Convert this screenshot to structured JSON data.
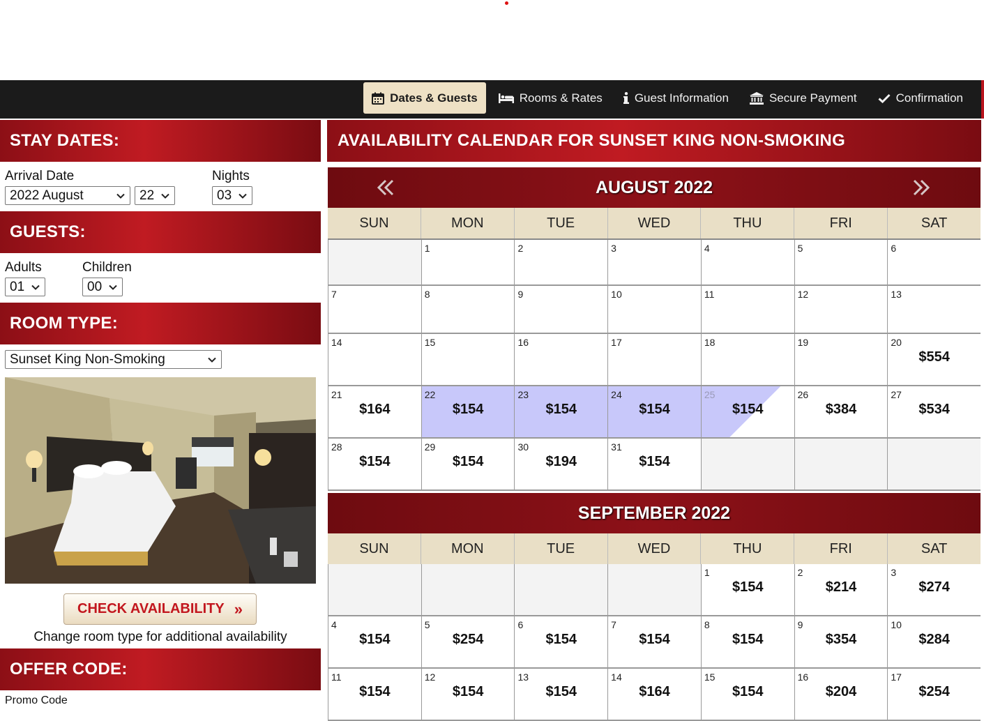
{
  "nav": {
    "items": [
      {
        "label": "Dates & Guests",
        "icon": "calendar-icon",
        "active": true
      },
      {
        "label": "Rooms & Rates",
        "icon": "bed-icon",
        "active": false
      },
      {
        "label": "Guest Information",
        "icon": "info-icon",
        "active": false
      },
      {
        "label": "Secure Payment",
        "icon": "bank-icon",
        "active": false
      },
      {
        "label": "Confirmation",
        "icon": "checkmark-icon",
        "active": false
      }
    ]
  },
  "stay": {
    "heading": "STAY DATES:",
    "arrival_label": "Arrival Date",
    "arrival_month": "2022 August",
    "arrival_day": "22",
    "nights_label": "Nights",
    "nights": "03"
  },
  "guests": {
    "heading": "GUESTS:",
    "adults_label": "Adults",
    "adults": "01",
    "children_label": "Children",
    "children": "00"
  },
  "room": {
    "heading": "ROOM TYPE:",
    "selected": "Sunset King Non-Smoking"
  },
  "check_button": "CHECK AVAILABILITY",
  "note": "Change room type for additional availability",
  "offer": {
    "heading": "OFFER CODE:",
    "label": "Promo Code"
  },
  "calendar": {
    "title": "AVAILABILITY CALENDAR FOR SUNSET KING NON-SMOKING",
    "days": [
      "SUN",
      "MON",
      "TUE",
      "WED",
      "THU",
      "FRI",
      "SAT"
    ],
    "colors": {
      "selected": "#c8c8fa",
      "header": "#8d1118",
      "dow": "#e9dfc6"
    },
    "months": [
      {
        "name": "AUGUST 2022",
        "weeks": [
          [
            null,
            {
              "d": "1"
            },
            {
              "d": "2"
            },
            {
              "d": "3"
            },
            {
              "d": "4"
            },
            {
              "d": "5"
            },
            {
              "d": "6"
            }
          ],
          [
            {
              "d": "7"
            },
            {
              "d": "8"
            },
            {
              "d": "9"
            },
            {
              "d": "10"
            },
            {
              "d": "11"
            },
            {
              "d": "12"
            },
            {
              "d": "13"
            }
          ],
          [
            {
              "d": "14"
            },
            {
              "d": "15"
            },
            {
              "d": "16"
            },
            {
              "d": "17"
            },
            {
              "d": "18"
            },
            {
              "d": "19"
            },
            {
              "d": "20",
              "p": "$554"
            }
          ],
          [
            {
              "d": "21",
              "p": "$164"
            },
            {
              "d": "22",
              "p": "$154",
              "s": "sel"
            },
            {
              "d": "23",
              "p": "$154",
              "s": "sel"
            },
            {
              "d": "24",
              "p": "$154",
              "s": "sel"
            },
            {
              "d": "25",
              "p": "$154",
              "s": "depart"
            },
            {
              "d": "26",
              "p": "$384"
            },
            {
              "d": "27",
              "p": "$534"
            }
          ],
          [
            {
              "d": "28",
              "p": "$154"
            },
            {
              "d": "29",
              "p": "$154"
            },
            {
              "d": "30",
              "p": "$194"
            },
            {
              "d": "31",
              "p": "$154"
            },
            null,
            null,
            null
          ]
        ]
      },
      {
        "name": "SEPTEMBER 2022",
        "weeks": [
          [
            null,
            null,
            null,
            null,
            {
              "d": "1",
              "p": "$154"
            },
            {
              "d": "2",
              "p": "$214"
            },
            {
              "d": "3",
              "p": "$274"
            }
          ],
          [
            {
              "d": "4",
              "p": "$154"
            },
            {
              "d": "5",
              "p": "$254"
            },
            {
              "d": "6",
              "p": "$154"
            },
            {
              "d": "7",
              "p": "$154"
            },
            {
              "d": "8",
              "p": "$154"
            },
            {
              "d": "9",
              "p": "$354"
            },
            {
              "d": "10",
              "p": "$284"
            }
          ],
          [
            {
              "d": "11",
              "p": "$154"
            },
            {
              "d": "12",
              "p": "$154"
            },
            {
              "d": "13",
              "p": "$154"
            },
            {
              "d": "14",
              "p": "$164"
            },
            {
              "d": "15",
              "p": "$154"
            },
            {
              "d": "16",
              "p": "$204"
            },
            {
              "d": "17",
              "p": "$254"
            }
          ]
        ]
      }
    ]
  }
}
